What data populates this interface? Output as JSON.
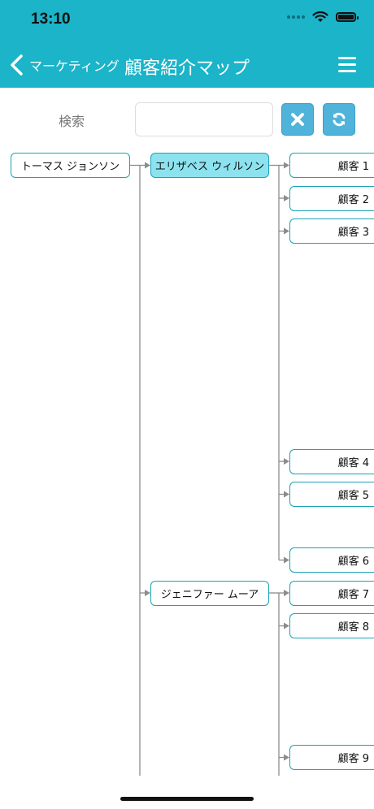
{
  "status": {
    "time": "13:10"
  },
  "nav": {
    "back_label": "マーケティング",
    "title": "顧客紹介マップ"
  },
  "search": {
    "label": "検索",
    "value": "",
    "placeholder": ""
  },
  "tree": {
    "root": {
      "name": "トーマス ジョンソン"
    },
    "referrers": [
      {
        "name": "エリザベス ウィルソン",
        "selected": true,
        "customers": [
          "顧客 1",
          "顧客 2",
          "顧客 3",
          "顧客 4",
          "顧客 5",
          "顧客 6"
        ]
      },
      {
        "name": "ジェニファー ムーア",
        "selected": false,
        "customers": [
          "顧客 7",
          "顧客 8",
          "顧客 9"
        ]
      }
    ]
  },
  "colors": {
    "header": "#1bb4c9",
    "node_border": "#1aa3b6",
    "selected_node": "#8ce3ef",
    "button": "#4fb3da"
  }
}
